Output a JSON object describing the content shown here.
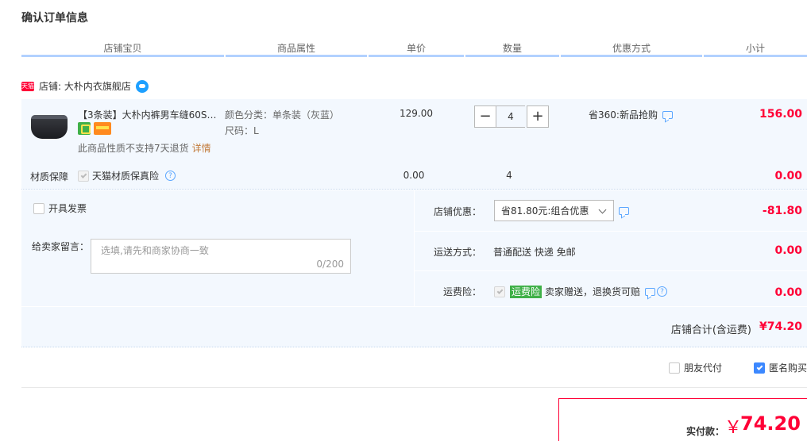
{
  "page": {
    "title": "确认订单信息"
  },
  "columns": [
    "店铺宝贝",
    "商品属性",
    "单价",
    "数量",
    "优惠方式",
    "小计"
  ],
  "shop": {
    "badge": "天猫",
    "label": "店铺: 大朴内衣旗舰店"
  },
  "item": {
    "title": "【3条装】大朴内裤男车缝60S…",
    "attr_color": "颜色分类：单条装（灰蓝）",
    "attr_size": "尺码：L",
    "price": "129.00",
    "quantity": "4",
    "minus": "−",
    "plus": "+",
    "promo": "省360:新品抢购",
    "subtotal": "156.00",
    "return_note": "此商品性质不支持7天退货",
    "detail_link": "详情"
  },
  "insurance": {
    "label": "材质保障",
    "name": "天猫材质保真险",
    "help": "?",
    "price": "0.00",
    "quantity": "4",
    "subtotal": "0.00"
  },
  "invoice": {
    "label": "开具发票"
  },
  "seller_message": {
    "label": "给卖家留言：",
    "placeholder": "选填,请先和商家协商一致",
    "count": "0/200"
  },
  "shop_discount": {
    "label": "店铺优惠：",
    "selected": "省81.80元:组合优惠",
    "amount": "-81.80"
  },
  "shipping": {
    "label": "运送方式：",
    "value": "普通配送 快递 免邮",
    "amount": "0.00"
  },
  "freight_insurance": {
    "label": "运费险：",
    "badge": "运费险",
    "text": "卖家赠送，退换货可赔",
    "amount": "0.00",
    "help": "?"
  },
  "shop_total": {
    "label": "店铺合计(含运费)",
    "amount": "¥74.20"
  },
  "options": {
    "friend_pay": "朋友代付",
    "anonymous": "匿名购买"
  },
  "payment": {
    "label": "实付款：",
    "currency": "￥",
    "amount": "74.20"
  },
  "colors": {
    "accent_red": "#ff0036",
    "header_bar": "#b2d1ff",
    "panel_bg": "#f3f8fe",
    "check_blue": "#3c88ff",
    "service_green": "#3fb048"
  }
}
